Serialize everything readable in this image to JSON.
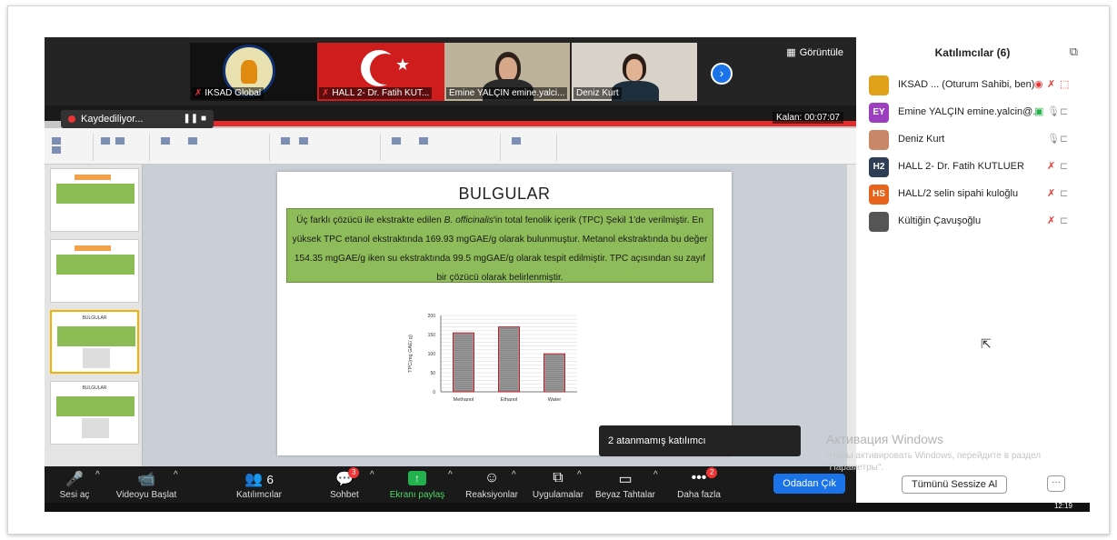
{
  "videos": [
    {
      "name": "IKSAD Global",
      "muted": true
    },
    {
      "name": "HALL 2- Dr. Fatih KUT...",
      "muted": true
    },
    {
      "name": "Emine YALÇIN emine.yalci...",
      "muted": false
    },
    {
      "name": "Deniz Kurt",
      "muted": false
    }
  ],
  "view_label": "Görüntüle",
  "recording": {
    "label": "Kaydediliyor..."
  },
  "timer": "Kalan: 00:07:07",
  "slide": {
    "title": "BULGULAR",
    "paragraph": {
      "pre": "Üç farklı çözücü ile ekstrakte edilen ",
      "italic": "B. officinalis",
      "post": "'in total fenolik içerik (TPC)  Şekil 1'de verilmiştir. En yüksek TPC etanol ekstraktında 169.93 mgGAE/g olarak bulunmuştur. Metanol ekstraktında bu değer 154.35 mgGAE/g iken su ekstraktında  99.5 mgGAE/g olarak tespit edilmiştir.   TPC açısından su zayıf bir çözücü olarak belirlenmiştir."
    }
  },
  "chart_data": {
    "type": "bar",
    "categories": [
      "Methanol",
      "Ethanol",
      "Water"
    ],
    "values": [
      154.35,
      169.93,
      99.5
    ],
    "ylabel": "TPC(mg GAE/ g)",
    "ylim": [
      0,
      200
    ],
    "yticks": [
      0,
      50,
      100,
      150,
      200
    ],
    "bar_fill": "#9a9a9a",
    "bar_stroke": "#c0202a"
  },
  "thumbnails": [
    {
      "title": "Daha/Fazlalar"
    },
    {
      "title": "Daha/Fazlalar"
    },
    {
      "title": "BULGULAR"
    },
    {
      "title": "BULGULAR"
    }
  ],
  "tooltip": "2 atanmamış katılımcı",
  "toolbar": {
    "mute": "Sesi aç",
    "video": "Videoyu Başlat",
    "participants": "Katılımcılar",
    "participants_count": "6",
    "chat": "Sohbet",
    "chat_badge": "3",
    "share": "Ekranı paylaş",
    "reactions": "Reaksiyonlar",
    "apps": "Uygulamalar",
    "whiteboard": "Beyaz Tahtalar",
    "more": "Daha fazla",
    "more_badge": "2",
    "leave": "Odadan Çık"
  },
  "panel": {
    "title": "Katılımcılar (6)",
    "participants": [
      {
        "initials": "",
        "name": "IKSAD ... (Oturum Sahibi, ben)",
        "color": "#e0a21a"
      },
      {
        "initials": "EY",
        "name": "Emine YALÇIN emine.yalcin@...",
        "color": "#9b3fc0"
      },
      {
        "initials": "",
        "name": "Deniz Kurt",
        "color": "#c88868"
      },
      {
        "initials": "H2",
        "name": "HALL 2- Dr. Fatih KUTLUER",
        "color": "#2f3e55"
      },
      {
        "initials": "HS",
        "name": "HALL/2 selin sipahi kuloğlu",
        "color": "#e8641c"
      },
      {
        "initials": "",
        "name": "Kültiğin Çavuşoğlu",
        "color": "#555555"
      }
    ],
    "mute_all": "Tümünü Sessize Al"
  },
  "windows_activation": {
    "title": "Активация Windows",
    "text": "Чтобы активировать Windows, перейдите в раздел \"Параметры\"."
  },
  "clock": "12:19"
}
